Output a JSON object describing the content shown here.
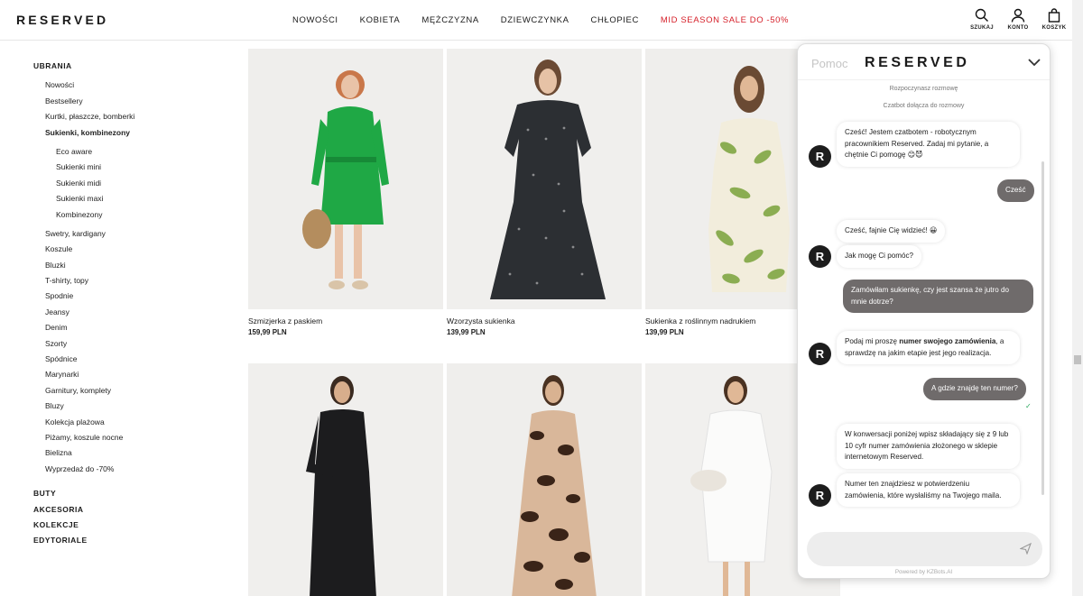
{
  "header": {
    "logo": "RESERVED",
    "nav": [
      "NOWOŚCI",
      "KOBIETA",
      "MĘŻCZYZNA",
      "DZIEWCZYNKA",
      "CHŁOPIEC"
    ],
    "sale": "MID SEASON SALE DO -50%",
    "icons": {
      "search": "SZUKAJ",
      "account": "KONTO",
      "cart": "KOSZYK"
    }
  },
  "sidebar": {
    "clothes_title": "UBRANIA",
    "items_top": [
      "Nowości",
      "Bestsellery",
      "Kurtki, płaszcze, bomberki",
      "Sukienki, kombinezony"
    ],
    "subitems": [
      "Eco aware",
      "Sukienki mini",
      "Sukienki midi",
      "Sukienki maxi",
      "Kombinezony"
    ],
    "items_bottom": [
      "Swetry, kardigany",
      "Koszule",
      "Bluzki",
      "T-shirty, topy",
      "Spodnie",
      "Jeansy",
      "Denim",
      "Szorty",
      "Spódnice",
      "Marynarki",
      "Garnitury, komplety",
      "Bluzy",
      "Kolekcja plażowa",
      "Piżamy, koszule nocne",
      "Bielizna",
      "Wyprzedaż do -70%"
    ],
    "categories": [
      "BUTY",
      "AKCESORIA",
      "KOLEKCJE",
      "EDYTORIALE"
    ]
  },
  "products": [
    {
      "name": "Szmizjerka z paskiem",
      "price": "159,99 PLN"
    },
    {
      "name": "Wzorzysta sukienka",
      "price": "139,99 PLN"
    },
    {
      "name": "Sukienka z roślinnym nadrukiem",
      "price": "139,99 PLN"
    }
  ],
  "chat": {
    "title": "Pomoc",
    "logo": "RESERVED",
    "sys1": "Rozpoczynasz rozmowę",
    "sys2": "Czatbot dołącza do rozmowy",
    "avatar": "R",
    "m1": "Cześć! Jestem czatbotem - robotycznym pracownikiem Reserved. Zadaj mi pytanie, a chętnie Ci pomogę 😊😈",
    "u1": "Cześć",
    "m2": "Cześć, fajnie Cię widzieć! 😀",
    "m3": "Jak mogę Ci pomóc?",
    "u2": "Zamówiłam sukienkę, czy jest szansa że jutro do mnie dotrze?",
    "m4_pre": "Podaj mi proszę ",
    "m4_bold": "numer swojego zamówienia",
    "m4_post": ", a sprawdzę na jakim etapie jest jego realizacja.",
    "u3": "A gdzie znajdę ten numer?",
    "check": "✓",
    "m5": "W konwersacji poniżej wpisz składający się z 9 lub 10 cyfr numer zamówienia złożonego w sklepie internetowym Reserved.",
    "m6": "Numer ten znajdziesz w potwierdzeniu zamówienia, które wysłaliśmy na Twojego maila.",
    "input_placeholder": "",
    "powered": "Powered by KZBots.AI"
  },
  "colors": {
    "sale": "#d6202a",
    "user_bubble": "#6f6b6b",
    "avatar": "#1d1d1d"
  }
}
